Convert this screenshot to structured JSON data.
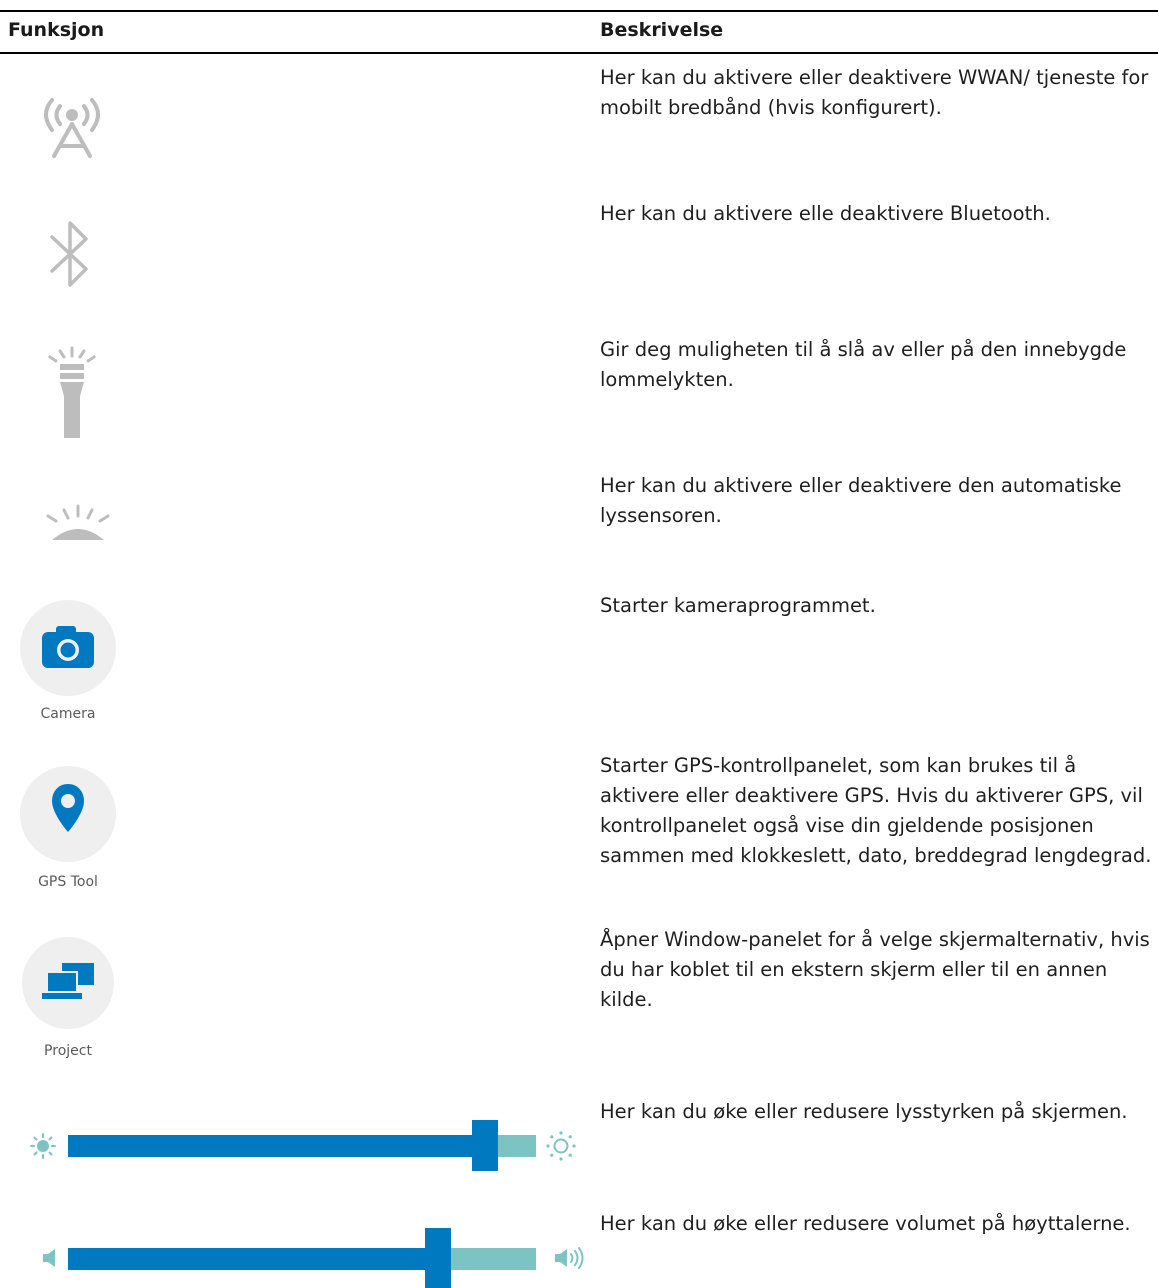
{
  "table": {
    "header_function": "Funksjon",
    "header_description": "Beskrivelse"
  },
  "rows": [
    {
      "icon": "wwan-antenna-icon",
      "description": "Her kan du aktivere eller deaktivere WWAN/ tjeneste for mobilt bredbånd (hvis konfigurert)."
    },
    {
      "icon": "bluetooth-icon",
      "description": "Her kan du aktivere elle deaktivere Bluetooth."
    },
    {
      "icon": "flashlight-icon",
      "description": "Gir deg muligheten til å slå av eller på den innebygde lommelykten."
    },
    {
      "icon": "light-sensor-icon",
      "description": "Her kan du aktivere eller deaktivere den automatiske lyssensoren."
    },
    {
      "icon": "camera-icon",
      "label": "Camera",
      "description": "Starter kameraprogrammet."
    },
    {
      "icon": "gps-pin-icon",
      "label": "GPS Tool",
      "description": "Starter GPS-kontrollpanelet, som kan brukes til å aktivere eller deaktivere GPS. Hvis du aktiverer GPS, vil kontrollpanelet også vise din gjeldende posisjonen sammen med klokkeslett, dato, breddegrad lengdegrad."
    },
    {
      "icon": "project-screens-icon",
      "label": "Project",
      "description": "Åpner Window-panelet for å velge skjermalternativ, hvis du har koblet til en ekstern skjerm eller til en annen kilde."
    },
    {
      "icon": "brightness-slider",
      "level": 0.89,
      "description": "Her kan du øke eller redusere lysstyrken på skjermen."
    },
    {
      "icon": "volume-slider",
      "level": 0.79,
      "description": "Her kan du øke eller redusere volumet på høyttalerne."
    }
  ],
  "colors": {
    "accent": "#0079c1",
    "slider_rest": "#7cc4c4",
    "icon_gray": "#bdbdbd",
    "tile_bg": "#efefef"
  }
}
